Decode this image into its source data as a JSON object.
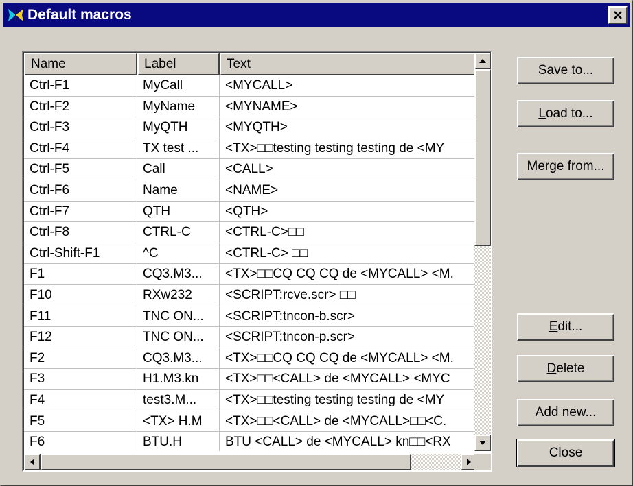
{
  "window": {
    "title": "Default macros"
  },
  "table": {
    "columns": [
      "Name",
      "Label",
      "Text"
    ],
    "rows": [
      {
        "name": "Ctrl-F1",
        "label": "MyCall",
        "text": "<MYCALL>"
      },
      {
        "name": "Ctrl-F2",
        "label": "MyName",
        "text": "<MYNAME>"
      },
      {
        "name": "Ctrl-F3",
        "label": "MyQTH",
        "text": "<MYQTH>"
      },
      {
        "name": "Ctrl-F4",
        "label": "TX test ...",
        "text": "<TX>□□testing testing testing de <MY"
      },
      {
        "name": "Ctrl-F5",
        "label": "Call",
        "text": "<CALL>"
      },
      {
        "name": "Ctrl-F6",
        "label": "Name",
        "text": "<NAME>"
      },
      {
        "name": "Ctrl-F7",
        "label": "QTH",
        "text": "<QTH>"
      },
      {
        "name": "Ctrl-F8",
        "label": "CTRL-C",
        "text": "<CTRL-C>□□"
      },
      {
        "name": "Ctrl-Shift-F1",
        "label": "^C",
        "text": "<CTRL-C> □□"
      },
      {
        "name": "F1",
        "label": "CQ3.M3...",
        "text": "<TX>□□CQ CQ CQ de <MYCALL> <M."
      },
      {
        "name": "F10",
        "label": "RXw232",
        "text": "<SCRIPT:rcve.scr> □□"
      },
      {
        "name": "F11",
        "label": "TNC ON...",
        "text": "<SCRIPT:tncon-b.scr>"
      },
      {
        "name": "F12",
        "label": "TNC ON...",
        "text": "<SCRIPT:tncon-p.scr>"
      },
      {
        "name": "F2",
        "label": "CQ3.M3...",
        "text": "<TX>□□CQ CQ CQ de <MYCALL> <M."
      },
      {
        "name": "F3",
        "label": "H1.M3.kn",
        "text": "<TX>□□<CALL> de <MYCALL> <MYC"
      },
      {
        "name": "F4",
        "label": "test3.M...",
        "text": "<TX>□□testing testing testing de <MY"
      },
      {
        "name": "F5",
        "label": "<TX> H.M",
        "text": "<TX>□□<CALL> de <MYCALL>□□<C."
      },
      {
        "name": "F6",
        "label": "BTU.H",
        "text": "BTU <CALL> de <MYCALL> kn□□<RX"
      }
    ]
  },
  "buttons": {
    "save_to": {
      "pre": "",
      "ul": "S",
      "post": "ave to..."
    },
    "load_to": {
      "pre": "",
      "ul": "L",
      "post": "oad to..."
    },
    "merge_from": {
      "pre": "",
      "ul": "M",
      "post": "erge from..."
    },
    "edit": {
      "pre": "",
      "ul": "E",
      "post": "dit..."
    },
    "delete": {
      "pre": "",
      "ul": "D",
      "post": "elete"
    },
    "add_new": {
      "pre": "",
      "ul": "A",
      "post": "dd new..."
    },
    "close": "Close"
  }
}
